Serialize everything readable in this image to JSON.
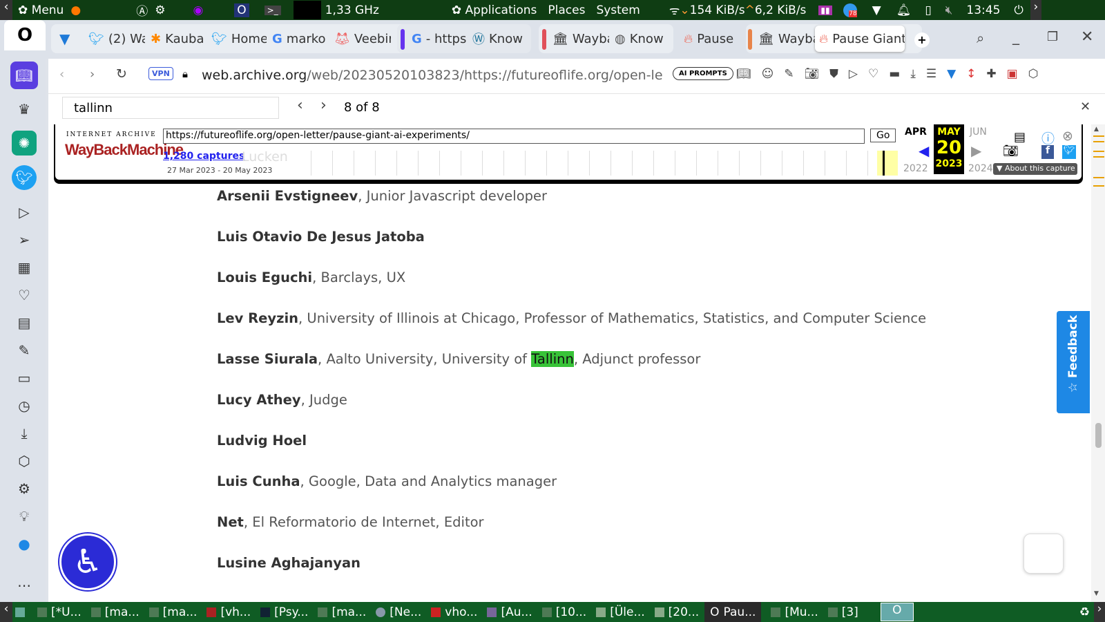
{
  "top_panel": {
    "menu": "Menu",
    "cpu": "1,33 GHz",
    "applications": "Applications",
    "places": "Places",
    "system": "System",
    "net_down": "154 KiB/s",
    "net_up": "6,2 KiB/s",
    "clock": "13:45",
    "badge": "78"
  },
  "tabs": [
    {
      "label": "(2) Wa"
    },
    {
      "label": "Kauba"
    },
    {
      "label": "Home"
    },
    {
      "label": "marko"
    },
    {
      "label": "Veebir"
    },
    {
      "label": "- https"
    },
    {
      "label": "Know"
    },
    {
      "label": "Wayba"
    },
    {
      "label": "Know"
    },
    {
      "label": "Pause"
    },
    {
      "label": "Wayba"
    },
    {
      "label": "Pause Giant",
      "active": true
    }
  ],
  "toolbar": {
    "vpn": "VPN",
    "url_host": "web.archive.org",
    "url_path": "/web/20230520103823/https://futureoflife.org/open-le",
    "ai_prompts": "AI PROMPTS"
  },
  "find": {
    "query": "tallinn",
    "count": "8 of 8"
  },
  "wayback": {
    "logo_top": "INTERNET ARCHIVE",
    "logo": "WayBackMachine",
    "url": "https://futureoflife.org/open-letter/pause-giant-ai-experiments/",
    "go": "Go",
    "captures": "1,280 captures",
    "range": "27 Mar 2023 - 20 May 2023",
    "ghost": "Lucken Zhou",
    "prev_month": "APR",
    "cur_month": "MAY",
    "next_month": "JUN",
    "day": "20",
    "prev_year": "2022",
    "cur_year": "2023",
    "next_year": "2024",
    "about": "About this capture"
  },
  "signatories": [
    {
      "name": "Arsenii Evstigneev",
      "detail": ", Junior Javascript developer"
    },
    {
      "name": "Luis Otavio De Jesus Jatoba",
      "detail": ""
    },
    {
      "name": "Louis Eguchi",
      "detail": ", Barclays, UX"
    },
    {
      "name": "Lev Reyzin",
      "detail": ", University of Illinois at Chicago, Professor of Mathematics, Statistics, and Computer Science"
    },
    {
      "name": "Lasse Siurala",
      "detail_pre": ", Aalto University, University of ",
      "match": "Tallinn",
      "detail_post": ", Adjunct professor"
    },
    {
      "name": "Lucy Athey",
      "detail": ", Judge"
    },
    {
      "name": "Ludvig Hoel",
      "detail": ""
    },
    {
      "name": "Luis Cunha",
      "detail": ", Google, Data and Analytics manager"
    },
    {
      "name": "Net",
      "detail": ", El Reformatorio de Internet, Editor"
    },
    {
      "name": "Lusine Aghajanyan",
      "detail": ""
    }
  ],
  "feedback": "Feedback",
  "taskbar": [
    {
      "label": "[*U..."
    },
    {
      "label": "[ma..."
    },
    {
      "label": "[ma..."
    },
    {
      "label": "[vh..."
    },
    {
      "label": "[Psy..."
    },
    {
      "label": "[ma..."
    },
    {
      "label": "[Ne..."
    },
    {
      "label": "vho..."
    },
    {
      "label": "[Au..."
    },
    {
      "label": "[10..."
    },
    {
      "label": "[Üle..."
    },
    {
      "label": "[20..."
    },
    {
      "label": "Pau..."
    },
    {
      "label": "[Mu..."
    },
    {
      "label": "[3]"
    }
  ],
  "colors": {
    "panel": "#0f3d13",
    "taskbar": "#0f5c24",
    "highlight": "#38c338",
    "feedback": "#1e88e5",
    "accessibility": "#2b2bd6"
  }
}
